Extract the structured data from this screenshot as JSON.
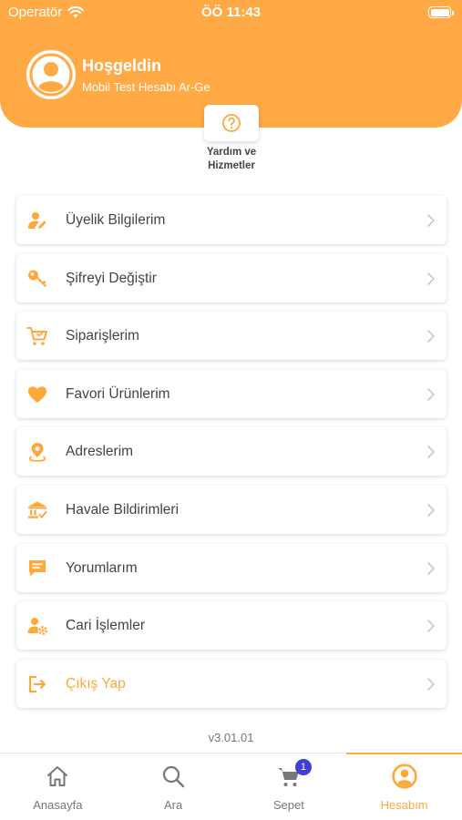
{
  "status_bar": {
    "carrier": "Operatör",
    "time": "ÖÖ 11:43"
  },
  "header": {
    "welcome": "Hoşgeldin",
    "account_name": "Mobil Test Hesabı Ar-Ge",
    "help_label": "Yardım ve Hizmetler"
  },
  "colors": {
    "accent": "#FFAA44",
    "badge": "#3F3FD8"
  },
  "menu": [
    {
      "label": "Üyelik Bilgilerim",
      "icon": "user-edit-icon"
    },
    {
      "label": "Şifreyi Değiştir",
      "icon": "key-icon"
    },
    {
      "label": "Siparişlerim",
      "icon": "cart-icon"
    },
    {
      "label": "Favori Ürünlerim",
      "icon": "heart-icon"
    },
    {
      "label": "Adreslerim",
      "icon": "location-pin-icon"
    },
    {
      "label": "Havale Bildirimleri",
      "icon": "bank-icon"
    },
    {
      "label": "Yorumlarım",
      "icon": "comment-icon"
    },
    {
      "label": "Cari İşlemler",
      "icon": "user-settings-icon"
    },
    {
      "label": "Çıkış Yap",
      "icon": "logout-icon"
    }
  ],
  "version": "v3.01.01",
  "tabbar": {
    "tabs": [
      {
        "label": "Anasayfa",
        "icon": "home-icon"
      },
      {
        "label": "Ara",
        "icon": "search-icon"
      },
      {
        "label": "Sepet",
        "icon": "cart-icon",
        "badge": "1"
      },
      {
        "label": "Hesabım",
        "icon": "account-icon",
        "active": true
      }
    ]
  }
}
